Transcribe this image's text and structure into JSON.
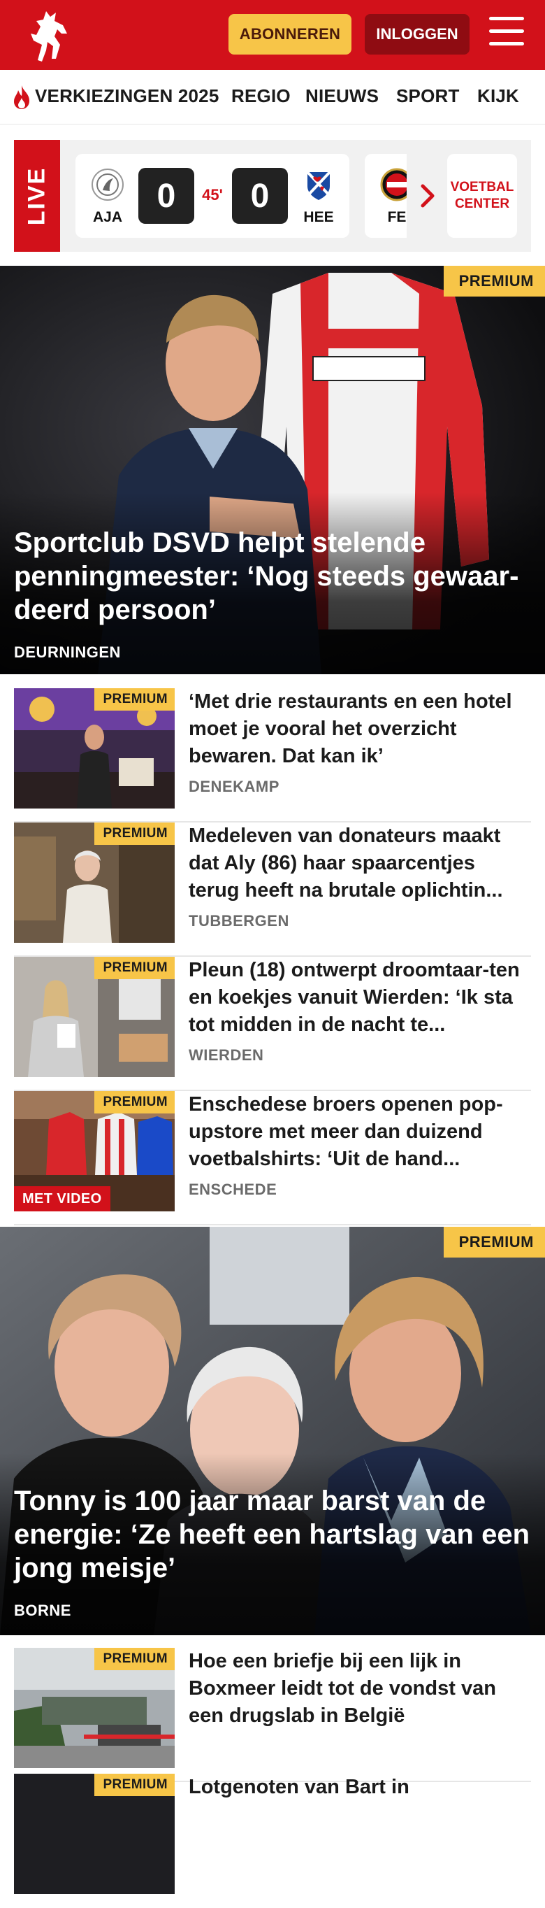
{
  "header": {
    "subscribe_label": "ABONNEREN",
    "login_label": "INLOGGEN",
    "brand_color": "#d2111a"
  },
  "nav": {
    "items": [
      "VERKIEZINGEN 2025",
      "REGIO",
      "NIEUWS",
      "SPORT",
      "KIJK"
    ]
  },
  "live": {
    "label": "LIVE",
    "match": {
      "home": "AJA",
      "home_score": "0",
      "minute": "45'",
      "away_score": "0",
      "away": "HEE"
    },
    "next_club": "FE",
    "voetbalcenter_label": "VOETBAL CENTER"
  },
  "hero1": {
    "premium": "PREMIUM",
    "title": "Sportclub DSVD helpt stelende penningmeester: ‘Nog steeds gewaar-deerd persoon’",
    "location": "DEURNINGEN"
  },
  "articles": [
    {
      "premium": "PREMIUM",
      "title": "‘Met drie restaurants en een hotel moet je vooral het overzicht bewaren. Dat kan ik’",
      "location": "DENEKAMP"
    },
    {
      "premium": "PREMIUM",
      "title": "Medeleven van donateurs maakt dat Aly (86) haar spaarcentjes terug heeft na brutale oplichtin...",
      "location": "TUBBERGEN"
    },
    {
      "premium": "PREMIUM",
      "title": "Pleun (18) ontwerpt droomtaar-ten en koekjes vanuit Wierden: ‘Ik sta tot midden in de nacht te...",
      "location": "WIERDEN"
    },
    {
      "premium": "PREMIUM",
      "video": "MET VIDEO",
      "title": "Enschedese broers openen pop-upstore met meer dan duizend voetbalshirts: ‘Uit de hand...",
      "location": "ENSCHEDE"
    }
  ],
  "hero2": {
    "premium": "PREMIUM",
    "title": "Tonny is 100 jaar maar barst van de energie: ‘Ze heeft een hartslag van een jong meisje’",
    "location": "BORNE"
  },
  "articles2": [
    {
      "premium": "PREMIUM",
      "title": "Hoe een briefje bij een lijk in Boxmeer leidt tot de vondst van een drugslab in België",
      "location": ""
    },
    {
      "premium": "PREMIUM",
      "title": "Lotgenoten van Bart in",
      "location": ""
    }
  ]
}
